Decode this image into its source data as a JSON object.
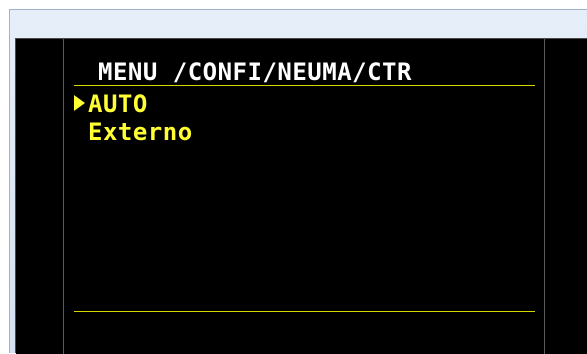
{
  "display": {
    "title": "MENU /CONFI/NEUMA/CTR",
    "items": [
      {
        "label": "AUTO",
        "selected": true
      },
      {
        "label": "Externo",
        "selected": false
      }
    ],
    "colors": {
      "background": "#000000",
      "title": "#ffffff",
      "item_text": "#ffff33",
      "rule": "#d6d600"
    },
    "cursor_icon": "triangle-right-icon"
  }
}
